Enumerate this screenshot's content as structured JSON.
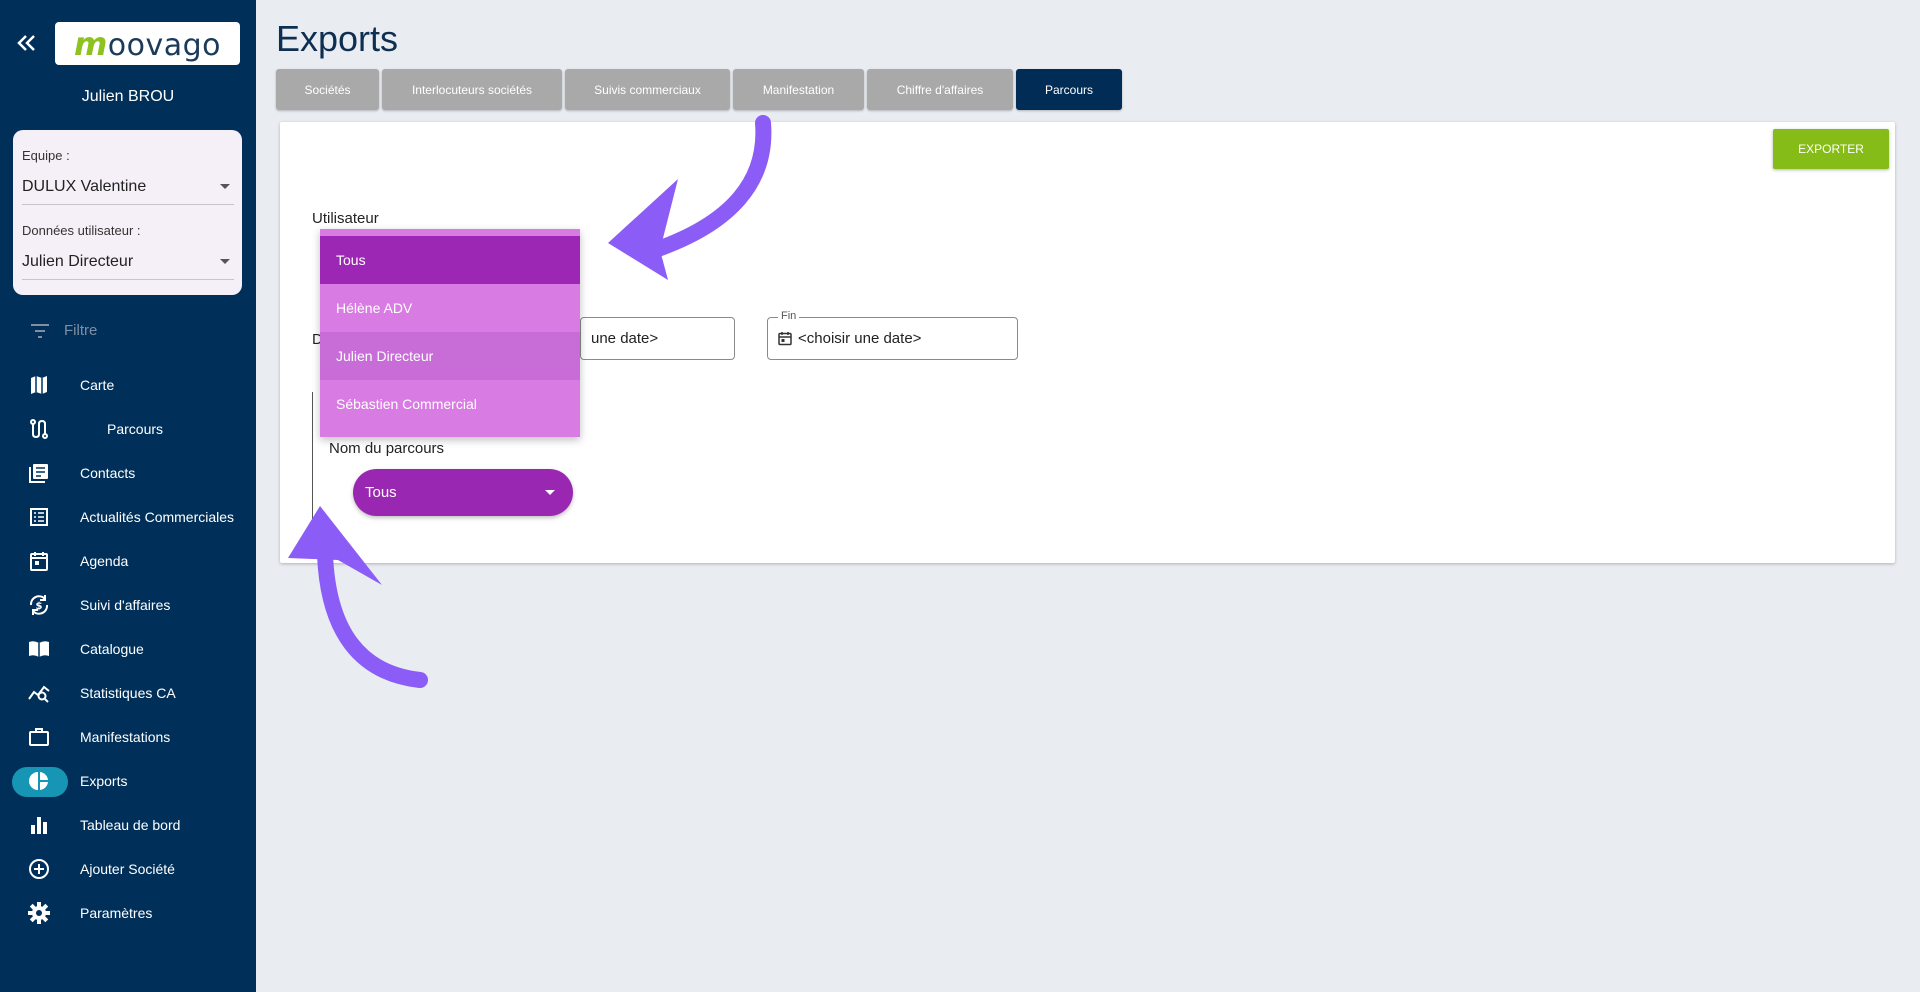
{
  "sidebar": {
    "logo_text": "oovago",
    "logo_letter": "m",
    "user_name": "Julien BROU",
    "team_label": "Equipe :",
    "team_value": "DULUX Valentine",
    "user_data_label": "Données utilisateur :",
    "user_data_value": "Julien Directeur",
    "filter_placeholder": "Filtre",
    "items": [
      {
        "label": "Carte",
        "icon": "map-icon"
      },
      {
        "label": "Parcours",
        "icon": "route-icon"
      },
      {
        "label": "Contacts",
        "icon": "contacts-icon"
      },
      {
        "label": "Actualités Commerciales",
        "icon": "news-icon"
      },
      {
        "label": "Agenda",
        "icon": "calendar-icon"
      },
      {
        "label": "Suivi d'affaires",
        "icon": "dollar-sync-icon"
      },
      {
        "label": "Catalogue",
        "icon": "book-icon"
      },
      {
        "label": "Statistiques CA",
        "icon": "stats-search-icon"
      },
      {
        "label": "Manifestations",
        "icon": "briefcase-icon"
      },
      {
        "label": "Exports",
        "icon": "pie-chart-icon"
      },
      {
        "label": "Tableau de bord",
        "icon": "bar-chart-icon"
      },
      {
        "label": "Ajouter Société",
        "icon": "add-circle-icon"
      },
      {
        "label": "Paramètres",
        "icon": "gear-icon"
      }
    ]
  },
  "main": {
    "title": "Exports",
    "tabs": [
      {
        "label": "Sociétés"
      },
      {
        "label": "Interlocuteurs sociétés"
      },
      {
        "label": "Suivis commerciaux"
      },
      {
        "label": "Manifestation"
      },
      {
        "label": "Chiffre d'affaires"
      },
      {
        "label": "Parcours"
      }
    ],
    "export_button": "EXPORTER",
    "user_label": "Utilisateur",
    "date_label_partial": "D",
    "start_date_value": "une date>",
    "end_date_legend": "Fin",
    "end_date_value": "<choisir une date>",
    "route_name_label": "Nom du parcours",
    "route_name_value": "Tous",
    "dropdown_options": [
      {
        "label": "Tous"
      },
      {
        "label": "Hélène ADV"
      },
      {
        "label": "Julien Directeur"
      },
      {
        "label": "Sébastien Commercial"
      }
    ]
  },
  "colors": {
    "sidebar_bg": "#00305a",
    "active_pill": "#1795b5",
    "export_green": "#86bc17",
    "purple_select": "#9a27b2",
    "dropdown_bg": "#d87be3",
    "annotation_arrow": "#8b5cf6"
  }
}
